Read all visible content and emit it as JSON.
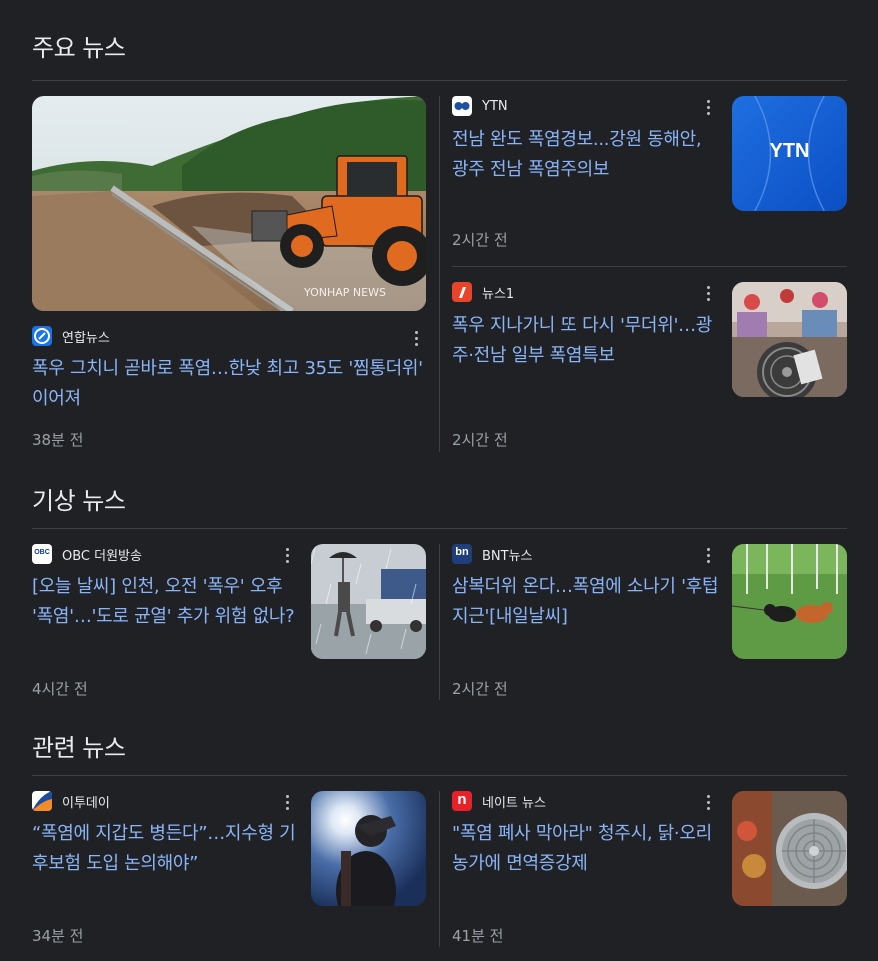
{
  "sections": [
    {
      "title": "주요 뉴스",
      "articles": [
        {
          "source": "연합뉴스",
          "headline": "폭우 그치니 곧바로 폭염…한낮 최고 35도 '찜통더위' 이어져",
          "time": "38분 전",
          "image_watermark": "YONHAP NEWS"
        },
        {
          "source": "YTN",
          "headline": "전남 완도 폭염경보...강원 동해안, 광주 전남 폭염주의보",
          "time": "2시간 전",
          "thumb_text": "YTN"
        },
        {
          "source": "뉴스1",
          "headline": "폭우 지나가니 또 다시 '무더위'…광주·전남 일부 폭염특보",
          "time": "2시간 전"
        }
      ]
    },
    {
      "title": "기상 뉴스",
      "articles": [
        {
          "source": "OBC 더원방송",
          "headline": "[오늘 날씨] 인천, 오전 '폭우' 오후 '폭염'…'도로 균열' 추가 위험 없나?",
          "time": "4시간 전",
          "logo_text": "OBC"
        },
        {
          "source": "BNT뉴스",
          "headline": "삼복더위 온다…폭염에 소나기 '후텁지근'[내일날씨]",
          "time": "2시간 전",
          "logo_text": "bn"
        }
      ]
    },
    {
      "title": "관련 뉴스",
      "articles": [
        {
          "source": "이투데이",
          "headline": "“폭염에 지갑도 병든다”…지수형 기후보험 도입 논의해야”",
          "time": "34분 전"
        },
        {
          "source": "네이트 뉴스",
          "headline": "\"폭염 폐사 막아라\" 청주시, 닭·오리 농가에 면역증강제",
          "time": "41분 전",
          "logo_text": "n"
        }
      ]
    }
  ],
  "colors": {
    "background": "#202124",
    "headline": "#8ab4f8",
    "text": "#e8eaed",
    "muted": "#9aa0a6",
    "divider": "#3c4043"
  },
  "icons": {
    "more": "more-vert-icon"
  }
}
